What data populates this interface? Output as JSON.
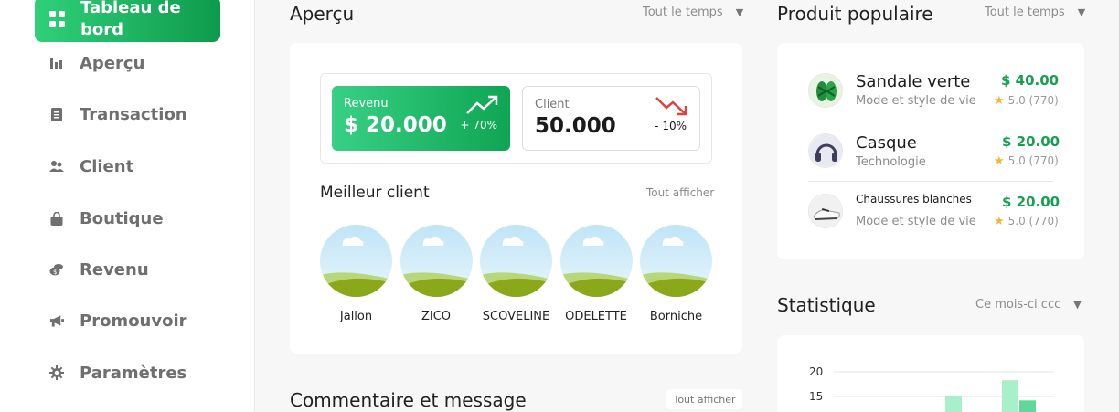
{
  "sidebar": {
    "active": {
      "label": "Tableau de bord",
      "icon": "dashboard-icon"
    },
    "items": [
      {
        "label": "Aperçu",
        "icon": "bar-chart-icon"
      },
      {
        "label": "Transaction",
        "icon": "document-icon"
      },
      {
        "label": "Client",
        "icon": "users-icon"
      },
      {
        "label": "Boutique",
        "icon": "shopping-bag-icon"
      },
      {
        "label": "Revenu",
        "icon": "coins-icon"
      },
      {
        "label": "Promouvoir",
        "icon": "megaphone-icon"
      },
      {
        "label": "Paramètres",
        "icon": "gear-icon"
      }
    ]
  },
  "overview": {
    "title": "Aperçu",
    "filter": "Tout le temps",
    "revenue": {
      "label": "Revenu",
      "value": "$ 20.000",
      "change": "+ 70%",
      "trend": "up",
      "color": "#ffffff"
    },
    "client": {
      "label": "Client",
      "value": "50.000",
      "change": "- 10%",
      "trend": "down",
      "trend_color": "#e0443a"
    },
    "best_clients": {
      "title": "Meilleur client",
      "link": "Tout afficher",
      "names": [
        "Jallon",
        "ZICO",
        "SCOVELINE",
        "ODELETTE",
        "Borniche"
      ]
    }
  },
  "comments": {
    "title": "Commentaire et message",
    "link": "Tout afficher"
  },
  "popular": {
    "title": "Produit populaire",
    "filter": "Tout le temps",
    "products": [
      {
        "name": "Sandale verte",
        "category": "Mode et style de vie",
        "price": "$ 40.00",
        "rating": "5.0 (770)"
      },
      {
        "name": "Casque",
        "category": "Technologie",
        "price": "$ 20.00",
        "rating": "5.0 (770)"
      },
      {
        "name": "Chaussures blanches",
        "category": "Mode et style de vie",
        "price": "$ 20.00",
        "rating": "5.0 (770)"
      }
    ]
  },
  "statistics": {
    "title": "Statistique",
    "filter": "Ce mois-ci ccc"
  },
  "colors": {
    "accent": "#1db35e",
    "price": "#18a052",
    "bar_light": "#a6f0c6",
    "bar_dark": "#4cd68f"
  },
  "chart_data": {
    "type": "bar",
    "yticks": [
      15,
      20
    ],
    "ylim": [
      0,
      20
    ],
    "series": [
      {
        "values": [
          null,
          null,
          15.2,
          null,
          18.3
        ]
      },
      {
        "values": [
          null,
          null,
          null,
          null,
          14.2
        ]
      }
    ]
  }
}
